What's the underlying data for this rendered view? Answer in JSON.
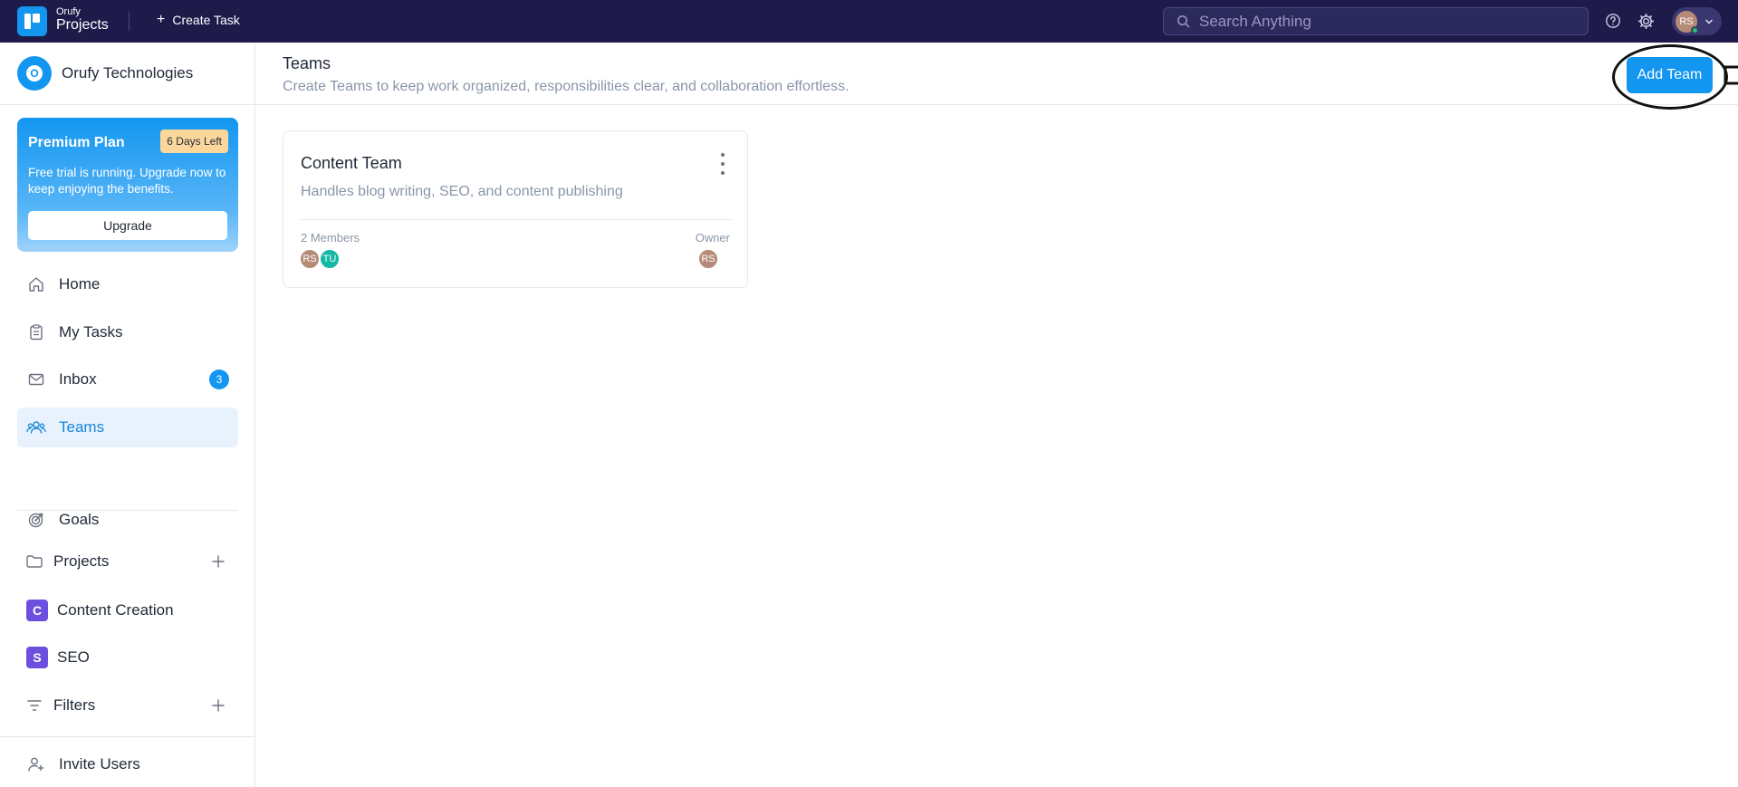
{
  "topbar": {
    "brand_line1": "Orufy",
    "brand_line2": "Projects",
    "create_task_label": "Create Task",
    "search_placeholder": "Search Anything",
    "user_initials": "RS"
  },
  "sidebar": {
    "org_initial": "O",
    "org_name": "Orufy Technologies",
    "premium": {
      "title": "Premium Plan",
      "days_left": "6 Days Left",
      "description": "Free trial is running. Upgrade now to keep enjoying the benefits.",
      "upgrade_label": "Upgrade"
    },
    "nav": {
      "home": "Home",
      "my_tasks": "My Tasks",
      "inbox": "Inbox",
      "inbox_count": "3",
      "teams": "Teams",
      "goals": "Goals"
    },
    "projects_label": "Projects",
    "projects": [
      {
        "initial": "C",
        "name": "Content Creation"
      },
      {
        "initial": "S",
        "name": "SEO"
      }
    ],
    "filters_label": "Filters",
    "invite_label": "Invite Users"
  },
  "page": {
    "title": "Teams",
    "subtitle": "Create Teams to keep work organized, responsibilities clear, and collaboration effortless.",
    "add_team_label": "Add Team"
  },
  "teams": [
    {
      "name": "Content Team",
      "description": "Handles blog writing, SEO, and content publishing",
      "members_label": "2 Members",
      "member_initials": [
        "RS",
        "TU"
      ],
      "owner_label": "Owner",
      "owner_initials": "RS"
    }
  ],
  "colors": {
    "topbar_bg": "#1e1b4b",
    "accent": "#1296f0",
    "active_nav_bg": "#e8f2fd",
    "project_icon": "#6d4fe0",
    "avatar_rs": "#b58b78",
    "avatar_tu": "#14b8a6"
  }
}
